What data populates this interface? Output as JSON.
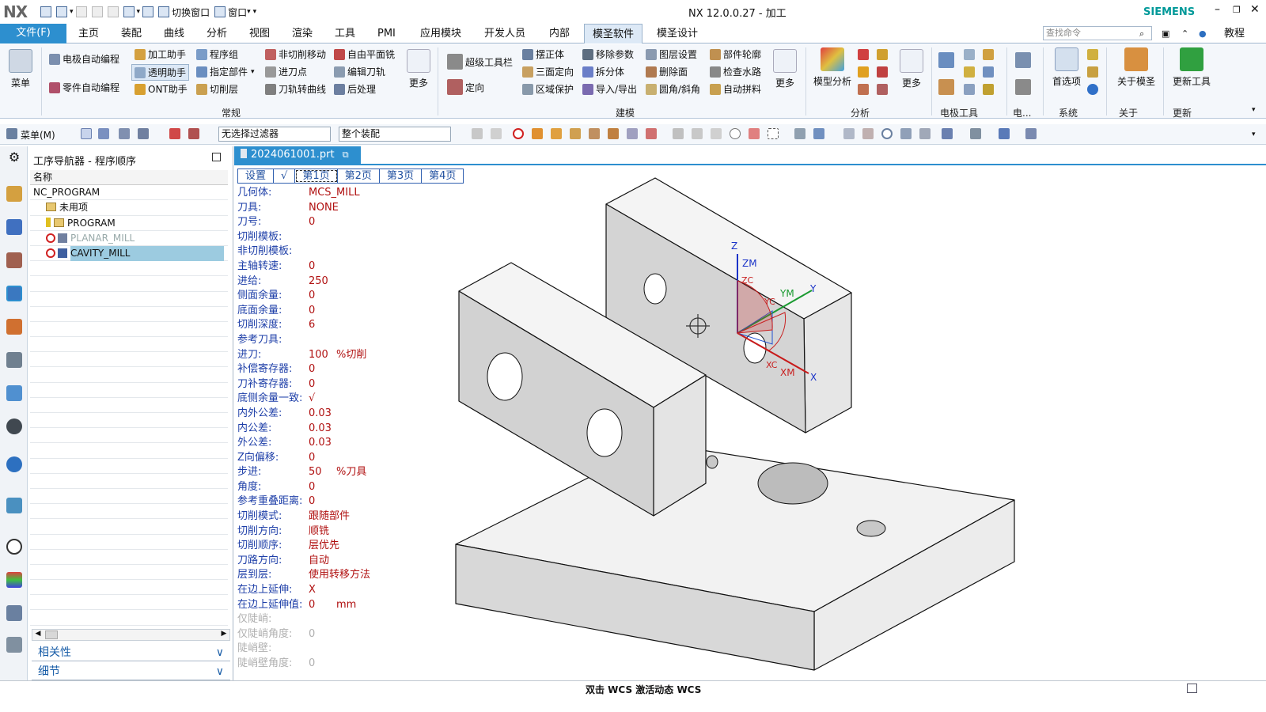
{
  "app": {
    "logo": "NX",
    "title": "NX 12.0.0.27 - 加工",
    "brand": "SIEMENS",
    "switch_window": "切换窗口",
    "window_menu": "窗口"
  },
  "menu": {
    "file": "文件(F)",
    "tabs": [
      "主页",
      "装配",
      "曲线",
      "分析",
      "视图",
      "渲染",
      "工具",
      "PMI",
      "应用模块",
      "开发人员",
      "内部",
      "模圣软件",
      "模圣设计"
    ],
    "active_tab": "模圣软件",
    "search_placeholder": "查找命令",
    "tutorial": "教程"
  },
  "ribbon": {
    "menu_btn": "菜单",
    "groups": {
      "general": {
        "label": "常规",
        "items": [
          "电极自动编程",
          "零件自动编程",
          "加工助手",
          "透明助手",
          "ONT助手",
          "程序组",
          "指定部件",
          "切削层",
          "非切削移动",
          "进刀点",
          "刀轨转曲线",
          "自由平面铣",
          "编辑刀轨",
          "后处理",
          "更多"
        ]
      },
      "modeling": {
        "label": "建模",
        "items": [
          "超级工具栏",
          "定向",
          "摆正体",
          "三面定向",
          "区域保护",
          "移除参数",
          "拆分体",
          "导入/导出",
          "图层设置",
          "删除面",
          "圆角/斜角",
          "部件轮廓",
          "检查水路",
          "自动拼料",
          "更多"
        ]
      },
      "analysis": {
        "label": "分析",
        "items": [
          "模型分析",
          "更多"
        ]
      },
      "electrode": {
        "label": "电极工具"
      },
      "electrode_short": {
        "label": "电..."
      },
      "system": {
        "label": "系统",
        "items": [
          "首选项"
        ]
      },
      "about": {
        "label": "关于",
        "items": [
          "关于模圣"
        ]
      },
      "update": {
        "label": "更新",
        "items": [
          "更新工具"
        ]
      }
    }
  },
  "toolbar2": {
    "menu": "菜单(M)",
    "filter": "无选择过滤器",
    "assembly": "整个装配"
  },
  "navigator": {
    "title": "工序导航器 - 程序顺序",
    "column": "名称",
    "rows": [
      {
        "label": "NC_PROGRAM",
        "indent": 0
      },
      {
        "label": "未用项",
        "indent": 1
      },
      {
        "label": "PROGRAM",
        "indent": 1
      },
      {
        "label": "PLANAR_MILL",
        "indent": 2
      },
      {
        "label": "CAVITY_MILL",
        "indent": 2
      }
    ],
    "selected": "CAVITY_MILL",
    "section1": "相关性",
    "section2": "细节"
  },
  "document": {
    "tab": "2024061001.prt"
  },
  "param_tabs": [
    "设置",
    "√",
    "第1页",
    "第2页",
    "第3页",
    "第4页"
  ],
  "params": [
    {
      "label": "几何体:",
      "value": "MCS_MILL"
    },
    {
      "label": "刀具:",
      "value": "NONE"
    },
    {
      "label": "刀号:",
      "value": "0"
    },
    {
      "label": "切削模板:",
      "value": ""
    },
    {
      "label": "非切削模板:",
      "value": ""
    },
    {
      "label": "主轴转速:",
      "value": "0"
    },
    {
      "label": "进给:",
      "value": "250"
    },
    {
      "label": "侧面余量:",
      "value": "0"
    },
    {
      "label": "底面余量:",
      "value": "0"
    },
    {
      "label": "切削深度:",
      "value": "6"
    },
    {
      "label": "参考刀具:",
      "value": ""
    },
    {
      "label": "进刀:",
      "value": "100",
      "unit": "%切削"
    },
    {
      "label": "补偿寄存器:",
      "value": "0"
    },
    {
      "label": "刀补寄存器:",
      "value": "0"
    },
    {
      "label": "底侧余量一致:",
      "value": "√"
    },
    {
      "label": "内外公差:",
      "value": "0.03"
    },
    {
      "label": "内公差:",
      "value": "0.03"
    },
    {
      "label": "外公差:",
      "value": "0.03"
    },
    {
      "label": "Z向偏移:",
      "value": "0"
    },
    {
      "label": "步进:",
      "value": "50",
      "unit": "%刀具"
    },
    {
      "label": "角度:",
      "value": "0"
    },
    {
      "label": "参考重叠距离:",
      "value": "0"
    },
    {
      "label": "切削模式:",
      "value": "跟随部件"
    },
    {
      "label": "切削方向:",
      "value": "顺铣"
    },
    {
      "label": "切削顺序:",
      "value": "层优先"
    },
    {
      "label": "刀路方向:",
      "value": "自动"
    },
    {
      "label": "层到层:",
      "value": "使用转移方法"
    },
    {
      "label": "在边上延伸:",
      "value": "X"
    },
    {
      "label": "在边上延伸值:",
      "value": "0",
      "unit": "mm"
    },
    {
      "label": "仅陡峭:",
      "value": "",
      "gray": true
    },
    {
      "label": "仅陡峭角度:",
      "value": "0",
      "gray": true
    },
    {
      "label": "陡峭壁:",
      "value": "",
      "gray": true
    },
    {
      "label": "陡峭壁角度:",
      "value": "0",
      "gray": true
    }
  ],
  "axes": {
    "z": "Z",
    "zm": "ZM",
    "zc": "ZC",
    "y": "Y",
    "ym": "YM",
    "yc": "YC",
    "x": "X",
    "xm": "XM",
    "xc": "XC"
  },
  "status": {
    "text": "双击 WCS 激活动态 WCS"
  },
  "colors": {
    "accent": "#2d8fcf",
    "label_blue": "#1e3fa8",
    "value_red": "#b01010",
    "selected_row": "#9ccbe0",
    "brand": "#009999"
  }
}
